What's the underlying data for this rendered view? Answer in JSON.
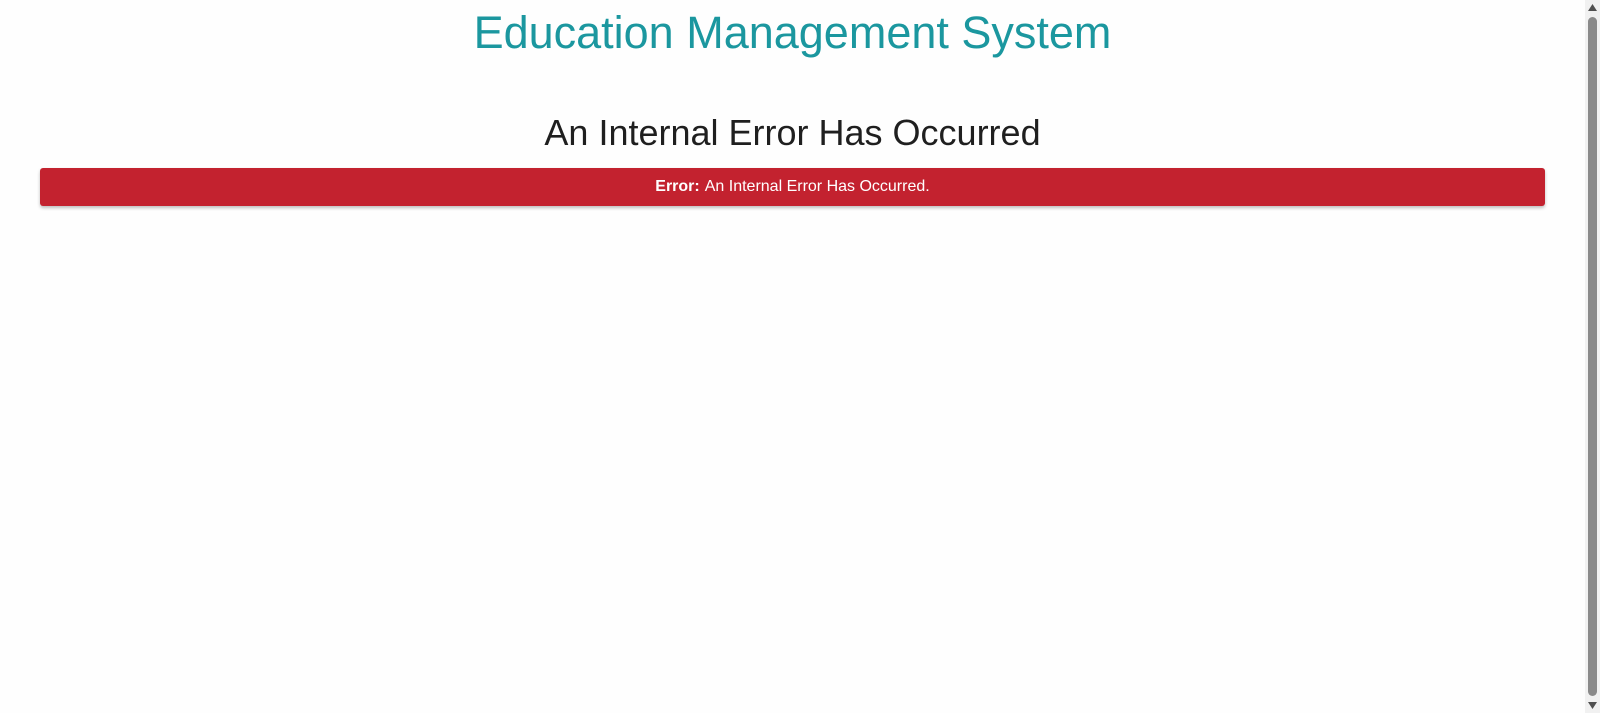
{
  "header": {
    "app_title": "Education Management System"
  },
  "main": {
    "page_title": "An Internal Error Has Occurred",
    "error_banner": {
      "label": "Error:",
      "message": "An Internal Error Has Occurred.",
      "color": "#c3222f"
    }
  },
  "theme": {
    "accent": "#1b979f"
  },
  "scrollbar": {
    "up_icon": "triangle-up-icon",
    "down_icon": "triangle-down-icon"
  }
}
